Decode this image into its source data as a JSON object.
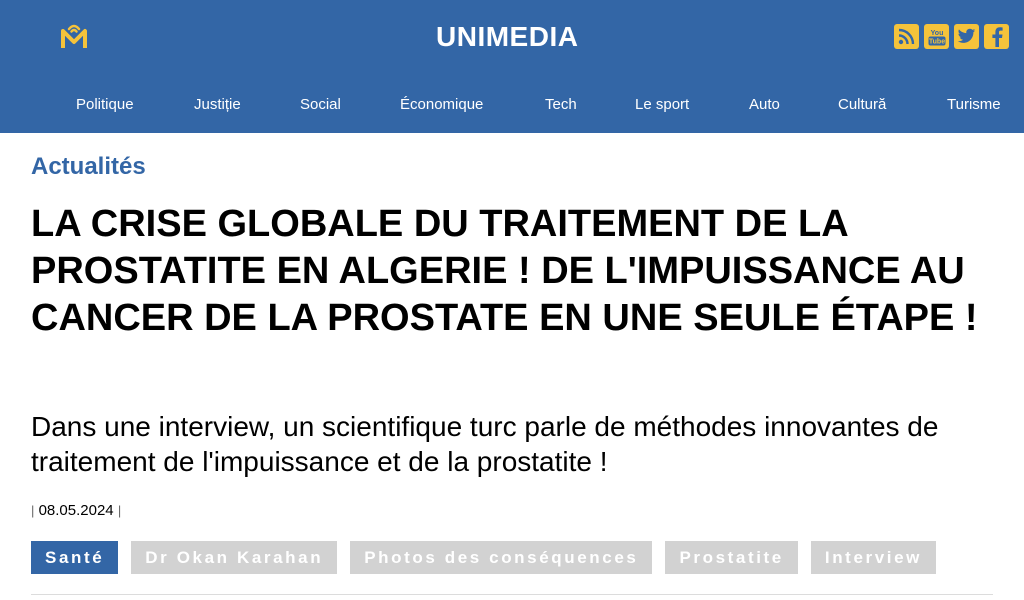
{
  "header": {
    "brand": "UNIMEDIA",
    "logo_icon": "m-logo-icon",
    "background_color": "#3366a6",
    "accent_color": "#f5c33b",
    "socials": [
      {
        "name": "rss-icon"
      },
      {
        "name": "youtube-icon",
        "label": "You Tube"
      },
      {
        "name": "twitter-icon"
      },
      {
        "name": "facebook-icon"
      }
    ]
  },
  "nav": {
    "items": [
      {
        "label": "Politique"
      },
      {
        "label": "Justiție"
      },
      {
        "label": "Social"
      },
      {
        "label": "Économique"
      },
      {
        "label": "Tech"
      },
      {
        "label": "Le sport"
      },
      {
        "label": "Auto"
      },
      {
        "label": "Cultură"
      },
      {
        "label": "Turisme"
      }
    ]
  },
  "article": {
    "section": "Actualités",
    "headline": "LA CRISE GLOBALE DU TRAITEMENT DE LA PROSTATITE EN ALGERIE ! DE L'IMPUISSANCE AU CANCER DE LA PROSTATE EN UNE SEULE ÉTAPE !",
    "subtitle": "Dans une interview, un scientifique turc parle de méthodes innovantes de traitement de l'impuissance et de la prostatite !",
    "date": "08.05.2024",
    "separator": "|",
    "tags": [
      {
        "label": "Santé",
        "active": true
      },
      {
        "label": "Dr Okan Karahan",
        "active": false
      },
      {
        "label": "Photos des conséquences",
        "active": false
      },
      {
        "label": "Prostatite",
        "active": false
      },
      {
        "label": "Interview",
        "active": false
      }
    ]
  }
}
